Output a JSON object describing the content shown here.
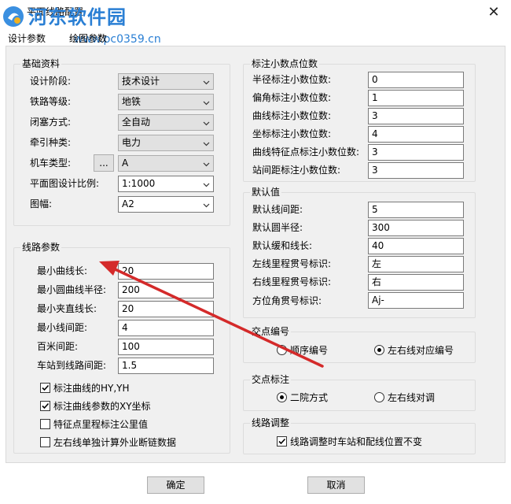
{
  "window": {
    "title": "平面线路配置",
    "close_glyph": "✕"
  },
  "watermark": {
    "name": "河东软件园",
    "url": "www.pc0359.cn"
  },
  "tabs": [
    {
      "label": "设计参数"
    },
    {
      "label": "绘图参数"
    }
  ],
  "basic": {
    "title": "基础资料",
    "design_stage": {
      "label": "设计阶段:",
      "value": "技术设计"
    },
    "railway_grade": {
      "label": "铁路等级:",
      "value": "地铁"
    },
    "block_mode": {
      "label": "闭塞方式:",
      "value": "全自动"
    },
    "traction": {
      "label": "牵引种类:",
      "value": "电力"
    },
    "locomotive": {
      "label": "机车类型:",
      "browse": "...",
      "value": "A"
    },
    "scale": {
      "label": "平面图设计比例:",
      "value": "1:1000"
    },
    "sheet": {
      "label": "图幅:",
      "value": "A2"
    }
  },
  "route": {
    "title": "线路参数",
    "fields": [
      {
        "label": "最小曲线长:",
        "value": "20"
      },
      {
        "label": "最小圆曲线半径:",
        "value": "200"
      },
      {
        "label": "最小夹直线长:",
        "value": "20"
      },
      {
        "label": "最小线间距:",
        "value": "4"
      },
      {
        "label": "百米间距:",
        "value": "100"
      },
      {
        "label": "车站到线路间距:",
        "value": "1.5"
      }
    ],
    "checks": [
      {
        "label": "标注曲线的HY,YH",
        "checked": true
      },
      {
        "label": "标注曲线参数的XY坐标",
        "checked": true
      },
      {
        "label": "特征点里程标注公里值",
        "checked": false
      },
      {
        "label": "左右线单独计算外业断链数据",
        "checked": false
      }
    ]
  },
  "decimals": {
    "title": "标注小数点位数",
    "fields": [
      {
        "label": "半径标注小数位数:",
        "value": "0"
      },
      {
        "label": "偏角标注小数位数:",
        "value": "1"
      },
      {
        "label": "曲线标注小数位数:",
        "value": "3"
      },
      {
        "label": "坐标标注小数位数:",
        "value": "4"
      },
      {
        "label": "曲线特征点标注小数位数:",
        "value": "3"
      },
      {
        "label": "站间距标注小数位数:",
        "value": "3"
      }
    ]
  },
  "defaults": {
    "title": "默认值",
    "fields": [
      {
        "label": "默认线间距:",
        "value": "5"
      },
      {
        "label": "默认圆半径:",
        "value": "300"
      },
      {
        "label": "默认缓和线长:",
        "value": "40"
      },
      {
        "label": "左线里程贯号标识:",
        "value": "左"
      },
      {
        "label": "右线里程贯号标识:",
        "value": "右"
      },
      {
        "label": "方位角贯号标识:",
        "value": "Aj-"
      }
    ]
  },
  "node_numbering": {
    "title": "交点编号",
    "options": [
      {
        "label": "顺序编号",
        "selected": false
      },
      {
        "label": "左右线对应编号",
        "selected": true
      }
    ]
  },
  "node_labeling": {
    "title": "交点标注",
    "options": [
      {
        "label": "二院方式",
        "selected": true
      },
      {
        "label": "左右线对调",
        "selected": false
      }
    ]
  },
  "route_adjust": {
    "title": "线路调整",
    "check": {
      "label": "线路调整时车站和配线位置不变",
      "checked": true
    }
  },
  "buttons": {
    "ok": "确定",
    "cancel": "取消"
  },
  "colors": {
    "annotation_arrow": "#d42a2a",
    "watermark_blue": "#2a7fd4"
  }
}
